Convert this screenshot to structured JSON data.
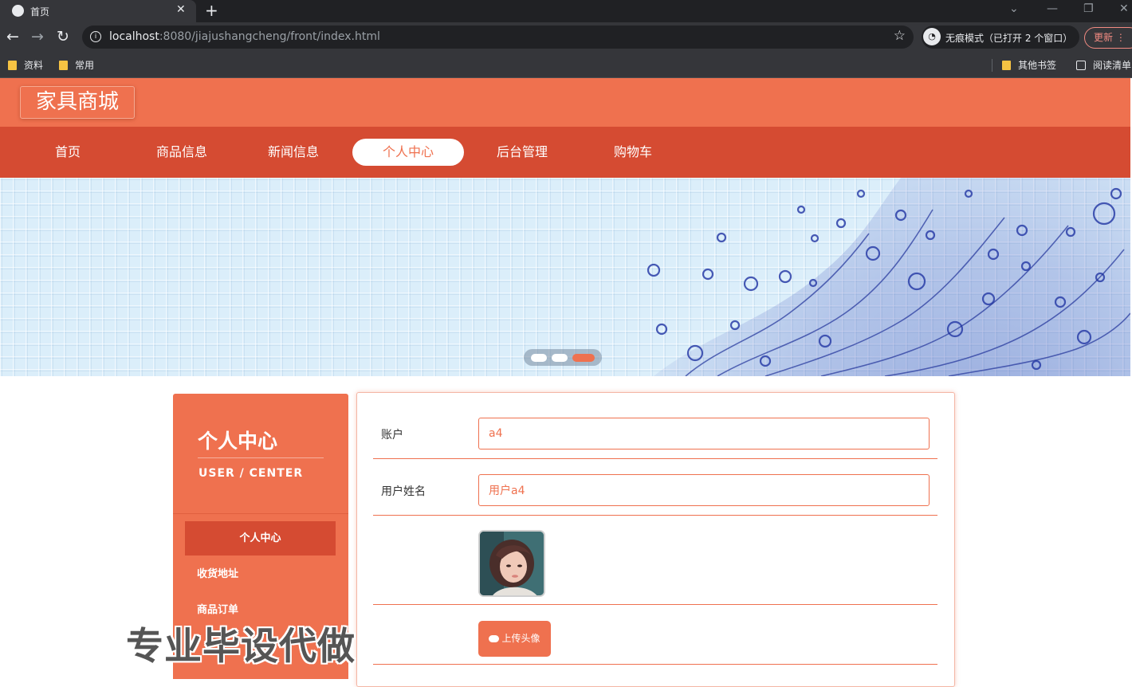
{
  "browser": {
    "tab_title": "首页",
    "url_host": "localhost",
    "url_rest": ":8080/jiajushangcheng/front/index.html",
    "incognito_text": "无痕模式（已打开 2 个窗口）",
    "update_label": "更新",
    "bookmarks": [
      "资料",
      "常用"
    ],
    "bookmarks_right": [
      "其他书签",
      "阅读清单"
    ]
  },
  "site": {
    "logo": "家具商城",
    "nav": [
      {
        "label": "首页",
        "active": false
      },
      {
        "label": "商品信息",
        "active": false
      },
      {
        "label": "新闻信息",
        "active": false
      },
      {
        "label": "个人中心",
        "active": true
      },
      {
        "label": "后台管理",
        "active": false
      },
      {
        "label": "购物车",
        "active": false
      }
    ]
  },
  "banner": {
    "slide_count": 3,
    "active_slide": 3
  },
  "sidebar": {
    "title": "个人中心",
    "subtitle": "USER / CENTER",
    "items": [
      {
        "label": "个人中心",
        "active": true
      },
      {
        "label": "收货地址",
        "active": false
      },
      {
        "label": "商品订单",
        "active": false
      }
    ]
  },
  "form": {
    "account_label": "账户",
    "account_value": "a4",
    "name_label": "用户姓名",
    "name_value": "用户a4",
    "upload_label": "上传头像"
  },
  "watermark": "专业毕设代做",
  "colors": {
    "primary": "#ef714f",
    "nav_bg": "#d54b32",
    "chrome_dark": "#202124",
    "chrome_mid": "#35363a"
  }
}
